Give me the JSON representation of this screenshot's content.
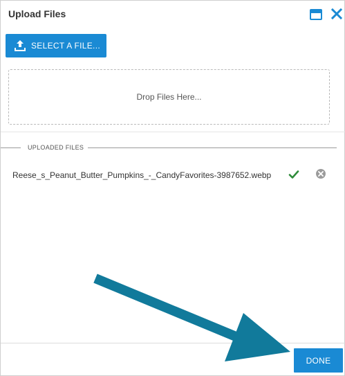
{
  "dialog": {
    "title": "Upload Files",
    "maximize_icon": "window-maximize-icon",
    "close_icon": "close-icon"
  },
  "toolbar": {
    "select_file_label": "SELECT A FILE...",
    "upload_icon": "upload-icon"
  },
  "dropzone": {
    "text": "Drop Files Here..."
  },
  "uploaded": {
    "section_title": "UPLOADED FILES",
    "files": [
      {
        "name": "Reese_s_Peanut_Butter_Pumpkins_-_CandyFavorites-3987652.webp",
        "status_icon": "check-icon",
        "remove_icon": "remove-icon"
      }
    ]
  },
  "footer": {
    "done_label": "DONE"
  },
  "colors": {
    "accent": "#1a8ad4",
    "success": "#2e8b3a",
    "annotation_arrow": "#117a9b"
  }
}
